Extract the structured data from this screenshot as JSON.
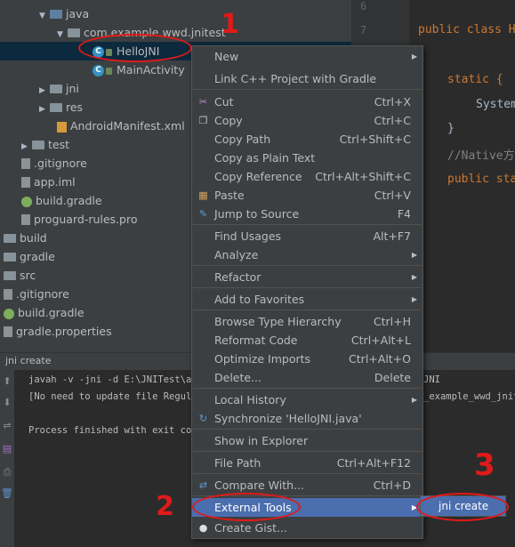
{
  "tree": {
    "rows": [
      {
        "label": "java"
      },
      {
        "label": "com.example.wwd.jnitest"
      },
      {
        "label": "HelloJNI"
      },
      {
        "label": "MainActivity"
      },
      {
        "label": "jni"
      },
      {
        "label": "res"
      },
      {
        "label": "AndroidManifest.xml"
      },
      {
        "label": "test"
      },
      {
        "label": ".gitignore"
      },
      {
        "label": "app.iml"
      },
      {
        "label": "build.gradle"
      },
      {
        "label": "proguard-rules.pro"
      },
      {
        "label": "build"
      },
      {
        "label": "gradle"
      },
      {
        "label": "src"
      },
      {
        "label": ".gitignore"
      },
      {
        "label": "build.gradle"
      },
      {
        "label": "gradle.properties"
      }
    ]
  },
  "editor": {
    "line_numbers": [
      "6",
      "7"
    ],
    "code": {
      "public_class": "public class H",
      "static": "static {",
      "system": "System",
      "close_brace": "}",
      "native_comment": "//Native方",
      "public_static": "public sta"
    }
  },
  "run_panel": {
    "title": "jni create",
    "lines": [
      "javah -v -jni -d E:\\JNITest\\app",
      "[No need to update file Regular",
      "",
      "Process finished with exit code"
    ],
    "right_fragments": [
      "JNI",
      "_example_wwd_jnite"
    ]
  },
  "menu": {
    "items": [
      {
        "label": "New",
        "shortcut": "",
        "submenu": true
      },
      {
        "label": "Link C++ Project with Gradle",
        "shortcut": "",
        "submenu": false
      },
      {
        "label": "Cut",
        "shortcut": "Ctrl+X",
        "submenu": false
      },
      {
        "label": "Copy",
        "shortcut": "Ctrl+C",
        "submenu": false
      },
      {
        "label": "Copy Path",
        "shortcut": "Ctrl+Shift+C",
        "submenu": false
      },
      {
        "label": "Copy as Plain Text",
        "shortcut": "",
        "submenu": false
      },
      {
        "label": "Copy Reference",
        "shortcut": "Ctrl+Alt+Shift+C",
        "submenu": false
      },
      {
        "label": "Paste",
        "shortcut": "Ctrl+V",
        "submenu": false
      },
      {
        "label": "Jump to Source",
        "shortcut": "F4",
        "submenu": false
      },
      {
        "label": "Find Usages",
        "shortcut": "Alt+F7",
        "submenu": false
      },
      {
        "label": "Analyze",
        "shortcut": "",
        "submenu": true
      },
      {
        "label": "Refactor",
        "shortcut": "",
        "submenu": true
      },
      {
        "label": "Add to Favorites",
        "shortcut": "",
        "submenu": true
      },
      {
        "label": "Browse Type Hierarchy",
        "shortcut": "Ctrl+H",
        "submenu": false
      },
      {
        "label": "Reformat Code",
        "shortcut": "Ctrl+Alt+L",
        "submenu": false
      },
      {
        "label": "Optimize Imports",
        "shortcut": "Ctrl+Alt+O",
        "submenu": false
      },
      {
        "label": "Delete...",
        "shortcut": "Delete",
        "submenu": false
      },
      {
        "label": "Local History",
        "shortcut": "",
        "submenu": true
      },
      {
        "label": "Synchronize 'HelloJNI.java'",
        "shortcut": "",
        "submenu": false
      },
      {
        "label": "Show in Explorer",
        "shortcut": "",
        "submenu": false
      },
      {
        "label": "File Path",
        "shortcut": "Ctrl+Alt+F12",
        "submenu": false
      },
      {
        "label": "Compare With...",
        "shortcut": "Ctrl+D",
        "submenu": false
      },
      {
        "label": "External Tools",
        "shortcut": "",
        "submenu": true
      },
      {
        "label": "Create Gist...",
        "shortcut": "",
        "submenu": false
      }
    ],
    "submenu_item": "jni create"
  },
  "annotations": {
    "one": "1",
    "two": "2",
    "three": "3"
  },
  "colors": {
    "selection": "#4b6eaf",
    "annotation": "#e01a1a",
    "menu_bg": "#3c3f41"
  }
}
